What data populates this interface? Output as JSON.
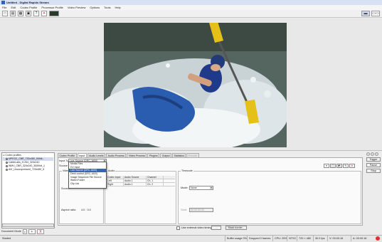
{
  "window": {
    "title": "Untitled - Digital Rapids Stream"
  },
  "menu": [
    "File",
    "Edit",
    "Codec Profile",
    "Processor Profile",
    "Video Preview",
    "Options",
    "Tools",
    "Help"
  ],
  "toolbar": {
    "icons": [
      "new-icon",
      "open-icon",
      "save-icon",
      "print-icon",
      "help-icon",
      "settings-icon",
      "meter-icon"
    ]
  },
  "preview": {
    "description_icon": "kayaker-video-frame"
  },
  "profiles": {
    "root": "Codec profiles",
    "items": [
      "MPEG2_CBR_720x480_6Mbit...",
      "CableLabs_H.264_320x240",
      "WMV_CBR_320x240_300Kbit_1",
      "AVI_Uncompressed_720x480_5"
    ],
    "selected_index": 0,
    "mode_label": "Document Mode",
    "add_label": "+",
    "remove_label": "X"
  },
  "tabs": [
    "Codec Profile",
    "Input",
    "Audio Levels",
    "Audio Process",
    "Video Process",
    "Plugins",
    "Output",
    "Statistics",
    "Encode"
  ],
  "active_tab": 1,
  "input": {
    "input_type_label": "Input Type",
    "input_type_value": "Live Source (DRC-1600)",
    "source_profile_label": "Source Profile",
    "video_legend": "Video",
    "audio_legend": "Audio",
    "timecode_legend": "Timecode",
    "source_label": "Source:",
    "aspect_label": "Aspect ratio:",
    "aspect_value": "4.0 : 3.0",
    "mode_label": "Mode:",
    "mode_value": "None",
    "start_label": "Start:",
    "start_value": "00:00:00:00",
    "external_timing_label": "Use external video timing",
    "black_border_label": "Black border..."
  },
  "dropdown": {
    "items": [
      "Media Files",
      "DV Input",
      "Live Source (DRC-1600)",
      "Deck control (DRC-1600)",
      "Image Sequence File Source",
      "Watch Folder",
      "Clip List"
    ],
    "selected_index": 2
  },
  "audio_table": {
    "headers": [
      "Codec Input",
      "Audio Source",
      "Channel"
    ],
    "rows": [
      [
        "Left",
        "Audio 1",
        "Ch. 1"
      ],
      [
        "Right",
        "Audio 1",
        "Ch. 2"
      ]
    ]
  },
  "side_buttons": [
    "Trigger",
    "Pause",
    "Stop"
  ],
  "status": {
    "left": "Started",
    "buffer": "Buffer usage 0%",
    "dropped": "Dropped 0 frames",
    "cpu": "CPU: 25%",
    "standard": "NTSC",
    "resolution": "720 × 480",
    "fps": "30.0 fps",
    "video_tc": "V: 00:00:16",
    "audio_tc": "A: 00:00:16"
  }
}
